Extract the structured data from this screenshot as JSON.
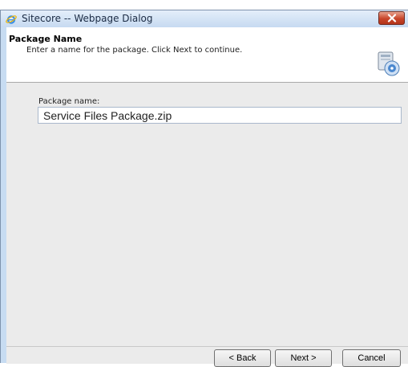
{
  "window": {
    "title": "Sitecore -- Webpage Dialog",
    "title_icon": "internet-explorer-icon",
    "close_icon": "close-icon"
  },
  "header": {
    "title": "Package Name",
    "subtitle": "Enter a name for the package. Click Next to continue.",
    "icon": "package-install-icon"
  },
  "form": {
    "package_name_label": "Package name:",
    "package_name_value": "Service Files Package.zip"
  },
  "buttons": {
    "back": "< Back",
    "next": "Next >",
    "cancel": "Cancel"
  },
  "colors": {
    "frame": "#c7dcf2",
    "client_background": "#ebebeb",
    "close_button": "#c8452a"
  }
}
